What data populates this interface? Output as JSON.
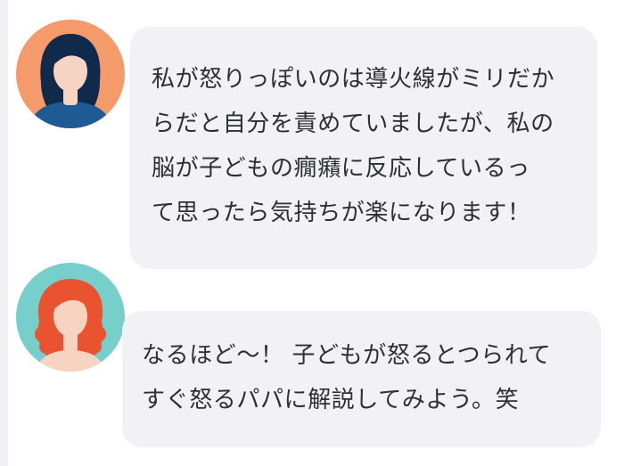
{
  "chat": {
    "messages": [
      {
        "sender": "user",
        "avatar_icon": "woman-dark-hair-icon",
        "avatar_bg": "#f59a6b",
        "lines": [
          "私が怒りっぽいのは導火線がミリだか",
          "らだと自分を責めていましたが、私の",
          "脳が子どもの癇癪に反応しているっ",
          "て思ったら気持ちが楽になります！"
        ]
      },
      {
        "sender": "assistant",
        "avatar_icon": "woman-red-hair-icon",
        "avatar_bg": "#76cfcb",
        "lines": [
          "なるほど〜！ 子どもが怒るとつられて",
          "すぐ怒るパパに解説してみよう。笑"
        ]
      }
    ]
  },
  "colors": {
    "bubble_bg": "#f1f1f6",
    "text": "#2e2e36",
    "rail": "#f1f1f4"
  }
}
